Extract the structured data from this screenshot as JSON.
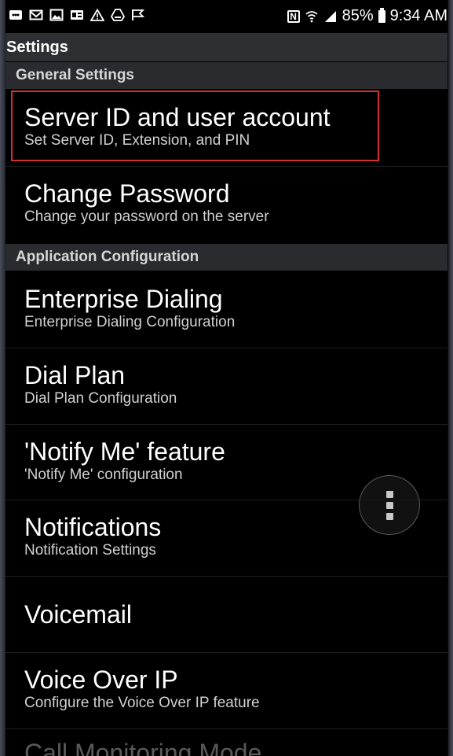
{
  "status_bar": {
    "left_icons": [
      "message-icon",
      "email-icon",
      "image-icon",
      "card-icon",
      "warning-icon",
      "drive-icon",
      "flag-icon"
    ],
    "nfc": "N",
    "battery": "85%",
    "time": "9:34 AM"
  },
  "action_bar": {
    "title": "Settings"
  },
  "sections": [
    {
      "header": "General Settings",
      "items": [
        {
          "title": "Server ID and user account",
          "summary": "Set Server ID, Extension, and PIN"
        },
        {
          "title": "Change Password",
          "summary": "Change your password on the server"
        }
      ]
    },
    {
      "header": "Application Configuration",
      "items": [
        {
          "title": "Enterprise Dialing",
          "summary": "Enterprise Dialing Configuration"
        },
        {
          "title": "Dial Plan",
          "summary": "Dial Plan Configuration"
        },
        {
          "title": "'Notify Me' feature",
          "summary": "'Notify Me' configuration"
        },
        {
          "title": "Notifications",
          "summary": "Notification Settings"
        },
        {
          "title": "Voicemail",
          "summary": ""
        },
        {
          "title": "Voice Over IP",
          "summary": "Configure the Voice Over IP feature"
        },
        {
          "title": "Call Monitoring Mode",
          "summary": ""
        }
      ]
    }
  ],
  "colors": {
    "background": "#000000",
    "header_bg": "#2a2b2e",
    "action_bar_bg": "#2e2f32",
    "highlight": "#d32f2f"
  },
  "fab_icon": "more-vert-icon"
}
